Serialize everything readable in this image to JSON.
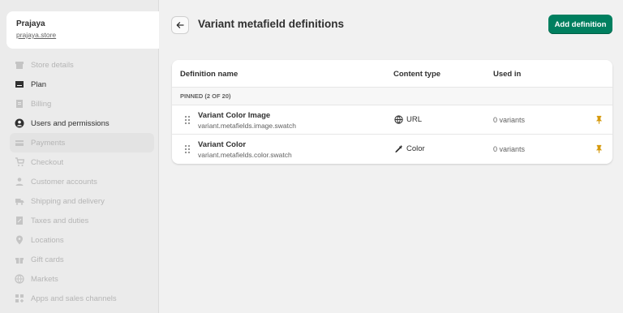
{
  "store": {
    "name": "Prajaya",
    "url": "prajaya.store"
  },
  "sidebar": {
    "items": [
      {
        "label": "Store details",
        "icon": "store-icon"
      },
      {
        "label": "Plan",
        "icon": "plan-icon"
      },
      {
        "label": "Billing",
        "icon": "billing-icon"
      },
      {
        "label": "Users and permissions",
        "icon": "user-icon"
      },
      {
        "label": "Payments",
        "icon": "payments-icon"
      },
      {
        "label": "Checkout",
        "icon": "cart-icon"
      },
      {
        "label": "Customer accounts",
        "icon": "person-icon"
      },
      {
        "label": "Shipping and delivery",
        "icon": "truck-icon"
      },
      {
        "label": "Taxes and duties",
        "icon": "tax-icon"
      },
      {
        "label": "Locations",
        "icon": "location-icon"
      },
      {
        "label": "Gift cards",
        "icon": "gift-icon"
      },
      {
        "label": "Markets",
        "icon": "globe-icon"
      },
      {
        "label": "Apps and sales channels",
        "icon": "apps-icon"
      }
    ]
  },
  "header": {
    "title": "Variant metafield definitions",
    "add_button": "Add definition"
  },
  "table": {
    "columns": {
      "name": "Definition name",
      "type": "Content type",
      "used": "Used in"
    },
    "section_label": "PINNED (2 OF 20)",
    "rows": [
      {
        "name": "Variant Color Image",
        "key": "variant.metafields.image.swatch",
        "type": "URL",
        "type_icon": "globe-icon",
        "used": "0 variants"
      },
      {
        "name": "Variant Color",
        "key": "variant.metafields.color.swatch",
        "type": "Color",
        "type_icon": "eyedropper-icon",
        "used": "0 variants"
      }
    ]
  },
  "colors": {
    "primary": "#007f5f",
    "pin": "#d69a0e"
  }
}
